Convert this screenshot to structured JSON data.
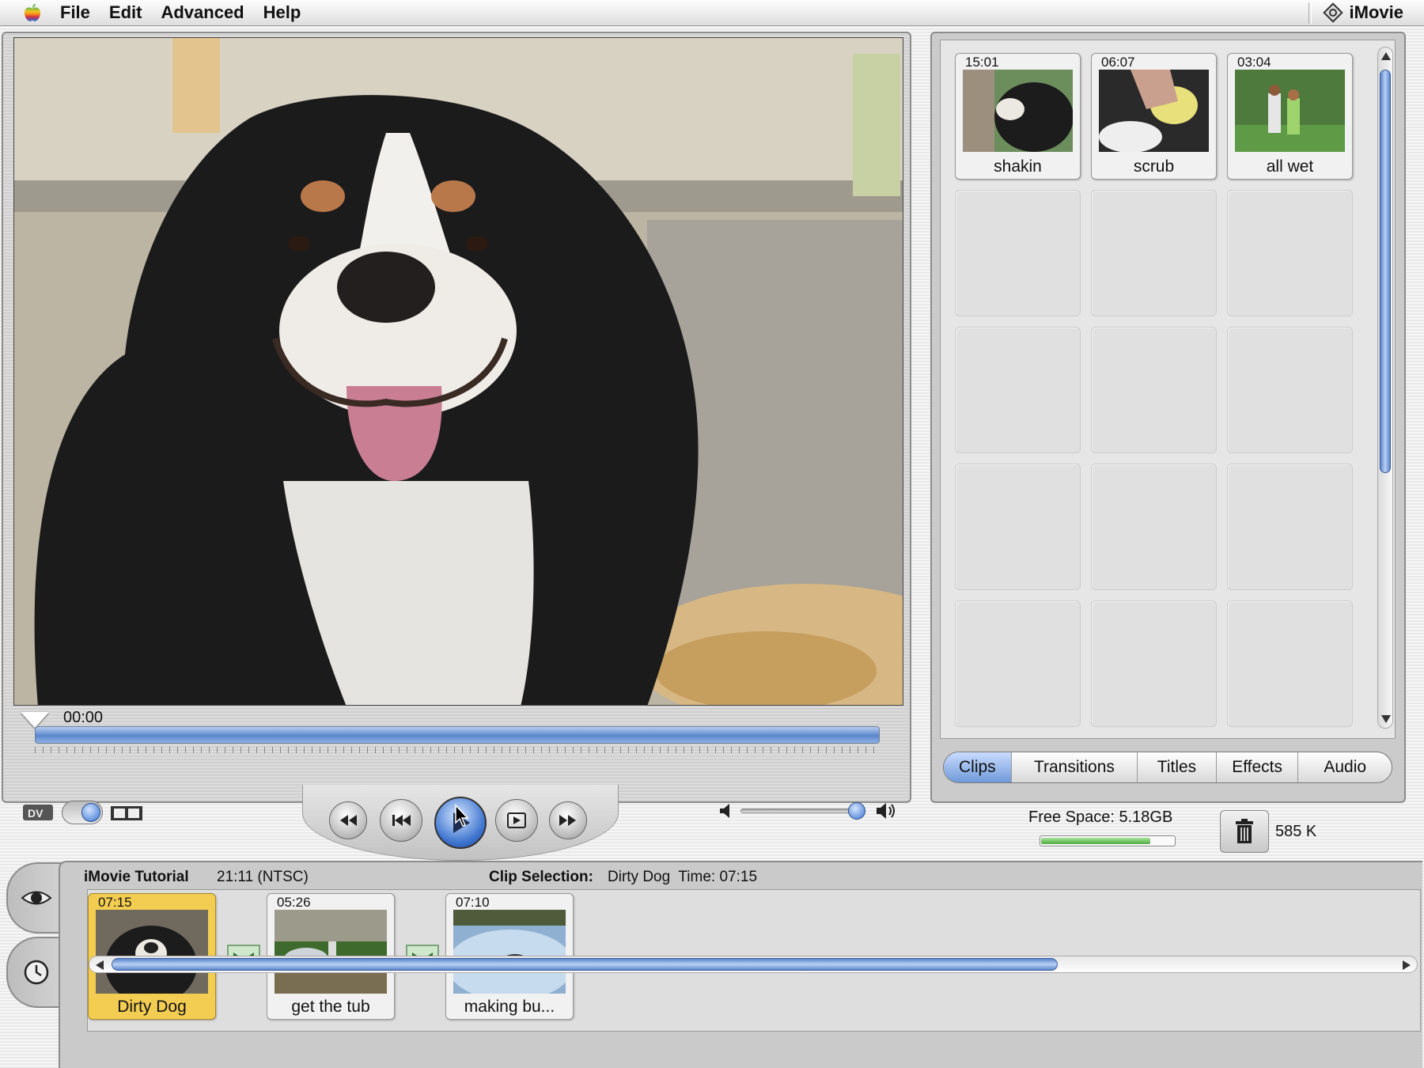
{
  "menubar": {
    "items": [
      "File",
      "Edit",
      "Advanced",
      "Help"
    ],
    "app_name": "iMovie",
    "apple_icon": "apple-logo-icon"
  },
  "monitor": {
    "timecode": "00:00",
    "playhead_fraction": 0.0,
    "mode": "edit",
    "volume_fraction": 0.9,
    "transport": [
      "rewind",
      "go-to-start",
      "play",
      "play-fullscreen",
      "fast-forward"
    ]
  },
  "shelf": {
    "clips": [
      {
        "duration": "15:01",
        "name": "shakin"
      },
      {
        "duration": "06:07",
        "name": "scrub"
      },
      {
        "duration": "03:04",
        "name": "all wet"
      }
    ],
    "empty_slots": 12,
    "tabs": [
      "Clips",
      "Transitions",
      "Titles",
      "Effects",
      "Audio"
    ],
    "active_tab": "Clips"
  },
  "status": {
    "free_space": "Free Space: 5.18GB",
    "free_space_fraction": 0.81,
    "trash_size": "585 K"
  },
  "timeline": {
    "project": "iMovie Tutorial",
    "project_duration": "21:11 (NTSC)",
    "selection_label": "Clip Selection:",
    "selection_value": "Dirty Dog  Time: 07:15",
    "clips": [
      {
        "duration": "07:15",
        "name": "Dirty Dog",
        "selected": true
      },
      {
        "duration": "05:26",
        "name": "get the tub",
        "selected": false
      },
      {
        "duration": "07:10",
        "name": "making bu...",
        "selected": false
      }
    ]
  },
  "colors": {
    "accent_blue": "#4f7fcf",
    "selected_clip": "#f3cd52",
    "transition_green": "#cfe8cb"
  }
}
